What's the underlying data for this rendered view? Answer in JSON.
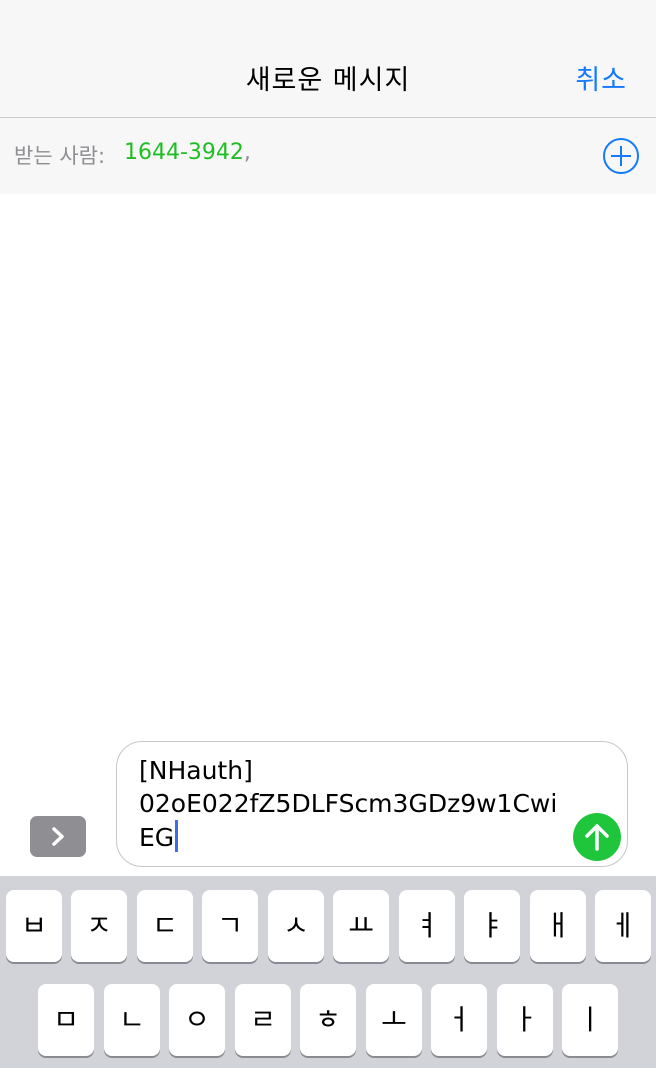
{
  "header": {
    "title": "새로운 메시지",
    "cancel_label": "취소"
  },
  "recipients": {
    "label": "받는 사람:",
    "numbers": [
      "1644-3942"
    ],
    "separator": ","
  },
  "compose": {
    "line1": "[NHauth]",
    "line2": "02oE022fZ5DLFScm3GDz9w1Cwi",
    "line3": "EG"
  },
  "colors": {
    "accent": "#127afb",
    "recipient": "#1fbe24",
    "send": "#1fc63b",
    "keyboard_bg": "#d1d3d9",
    "expand_button": "#8e8e93"
  },
  "keyboard": {
    "row1": [
      "ㅂ",
      "ㅈ",
      "ㄷ",
      "ㄱ",
      "ㅅ",
      "ㅛ",
      "ㅕ",
      "ㅑ",
      "ㅐ",
      "ㅔ"
    ],
    "row2": [
      "ㅁ",
      "ㄴ",
      "ㅇ",
      "ㄹ",
      "ㅎ",
      "ㅗ",
      "ㅓ",
      "ㅏ",
      "ㅣ"
    ]
  },
  "icons": {
    "add_contact": "plus-circle-icon",
    "expand": "chevron-right-icon",
    "send": "arrow-up-icon"
  }
}
